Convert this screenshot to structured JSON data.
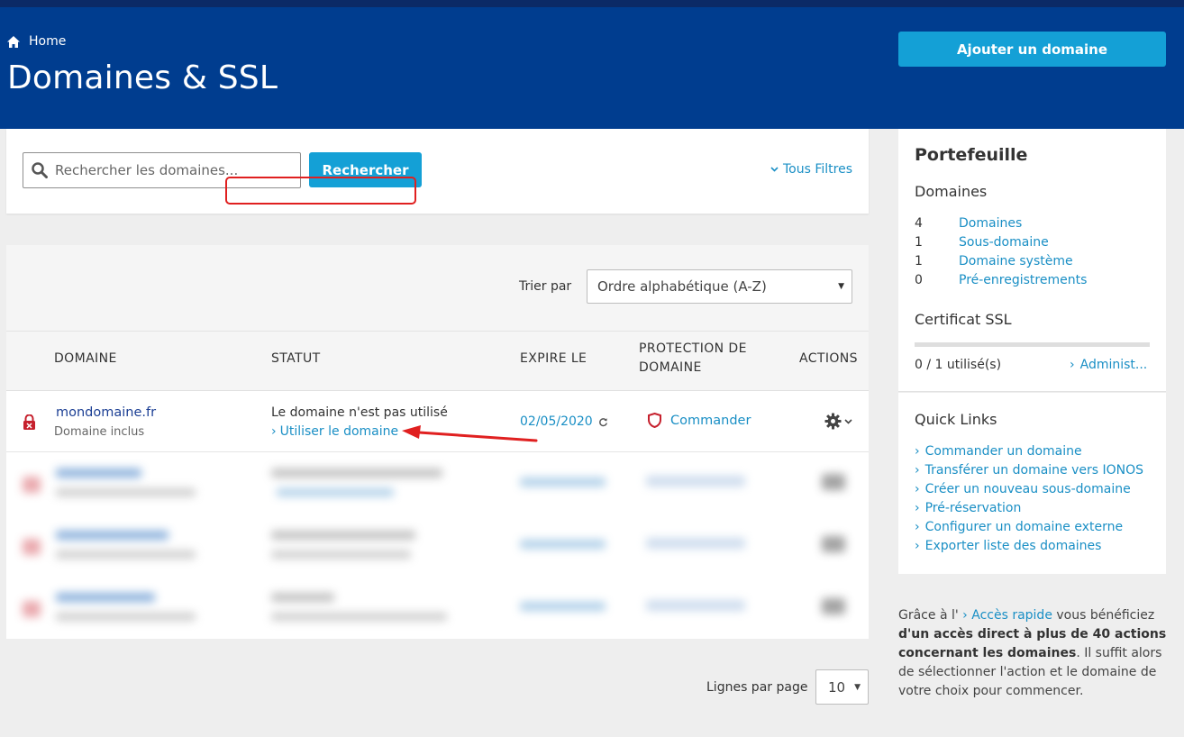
{
  "header": {
    "breadcrumb": "Home",
    "title": "Domaines & SSL",
    "add_button": "Ajouter un domaine"
  },
  "search": {
    "placeholder": "Rechercher les domaines...",
    "button": "Rechercher",
    "filters_link": "Tous Filtres"
  },
  "table": {
    "sort_label": "Trier par",
    "sort_value": "Ordre alphabétique (A-Z)",
    "columns": {
      "domain": "DOMAINE",
      "status": "STATUT",
      "expires": "EXPIRE LE",
      "protection_line1": "PROTECTION DE",
      "protection_line2": "DOMAINE",
      "actions": "ACTIONS"
    },
    "rows": [
      {
        "domain": "mondomaine.fr",
        "subtitle": "Domaine inclus",
        "status": "Le domaine n'est pas utilisé",
        "status_link": "Utiliser le domaine",
        "expires": "02/05/2020",
        "protection": "Commander"
      }
    ],
    "rows_per_page_label": "Lignes par page",
    "rows_per_page": "10"
  },
  "portfolio": {
    "title": "Portefeuille",
    "domains_heading": "Domaines",
    "stats": [
      {
        "count": "4",
        "label": "Domaines"
      },
      {
        "count": "1",
        "label": "Sous-domaine"
      },
      {
        "count": "1",
        "label": "Domaine système"
      },
      {
        "count": "0",
        "label": "Pré-enregistrements"
      }
    ],
    "ssl_heading": "Certificat SSL",
    "ssl_usage": "0 / 1 utilisé(s)",
    "ssl_usage_fraction": 0,
    "ssl_admin": "Administ..."
  },
  "quick_links": {
    "title": "Quick Links",
    "items": [
      "Commander un domaine",
      "Transférer un domaine vers IONOS",
      "Créer un nouveau sous-domaine",
      "Pré-réservation",
      "Configurer un domaine externe",
      "Exporter liste des domaines"
    ]
  },
  "help": {
    "prefix": "Grâce à l'",
    "link": "Accès rapide",
    "middle": " vous bénéficiez",
    "bold": "d'un accès direct à plus de 40 actions concernant les domaines",
    "suffix": ". Il suffit alors de sélectionner l'action et le domaine de votre choix pour commencer."
  },
  "colors": {
    "header_bg": "#003d8f",
    "accent": "#14a0d6",
    "link": "#1a8fc5",
    "annotation_red": "#e02020"
  }
}
